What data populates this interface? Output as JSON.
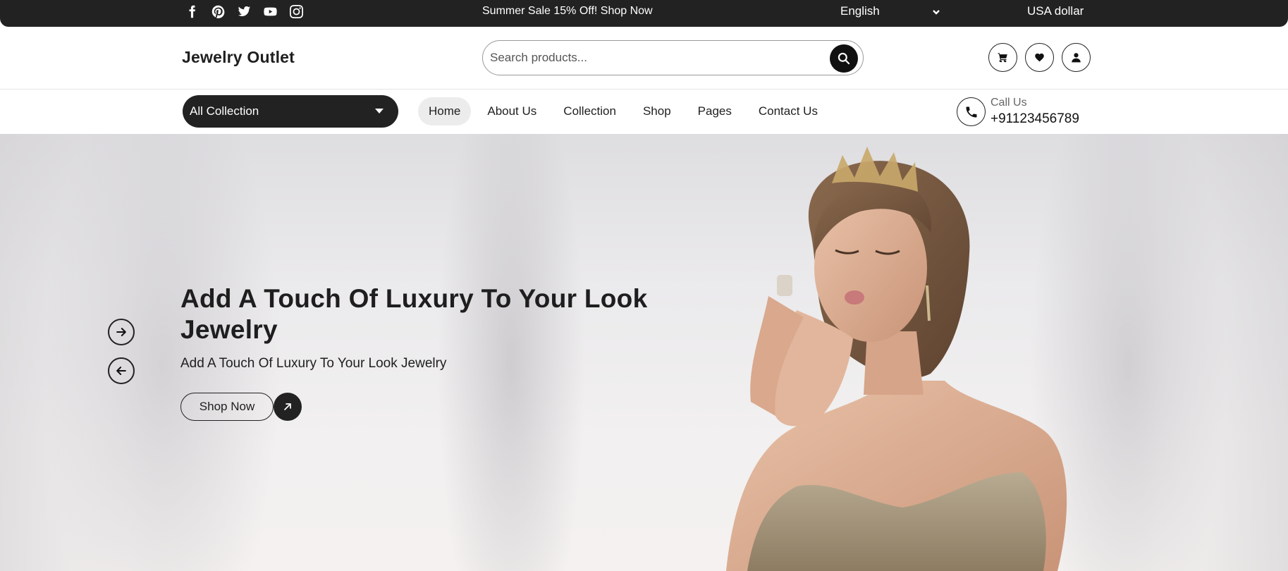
{
  "topbar": {
    "social_icons": [
      "facebook-icon",
      "pinterest-icon",
      "twitter-icon",
      "youtube-icon",
      "instagram-icon"
    ],
    "promo": "Summer Sale 15% Off! Shop Now",
    "language": "English",
    "currency": "USA dollar"
  },
  "header": {
    "brand": "Jewelry Outlet",
    "search_placeholder": "Search products...",
    "icons": [
      "cart-icon",
      "heart-icon",
      "user-icon"
    ]
  },
  "nav": {
    "all_collection": "All Collection",
    "items": [
      {
        "label": "Home",
        "active": true
      },
      {
        "label": "About Us",
        "active": false
      },
      {
        "label": "Collection",
        "active": false
      },
      {
        "label": "Shop",
        "active": false
      },
      {
        "label": "Pages",
        "active": false
      },
      {
        "label": "Contact Us",
        "active": false
      }
    ],
    "call_label": "Call Us",
    "call_number": "+91123456789"
  },
  "hero": {
    "title": "Add A Touch Of Luxury To Your Look Jewelry",
    "subtitle": "Add A Touch Of Luxury To Your Look Jewelry",
    "cta": "Shop Now"
  },
  "colors": {
    "dark": "#222222",
    "nav_active_bg": "#ececec",
    "text": "#1f1f1f"
  }
}
